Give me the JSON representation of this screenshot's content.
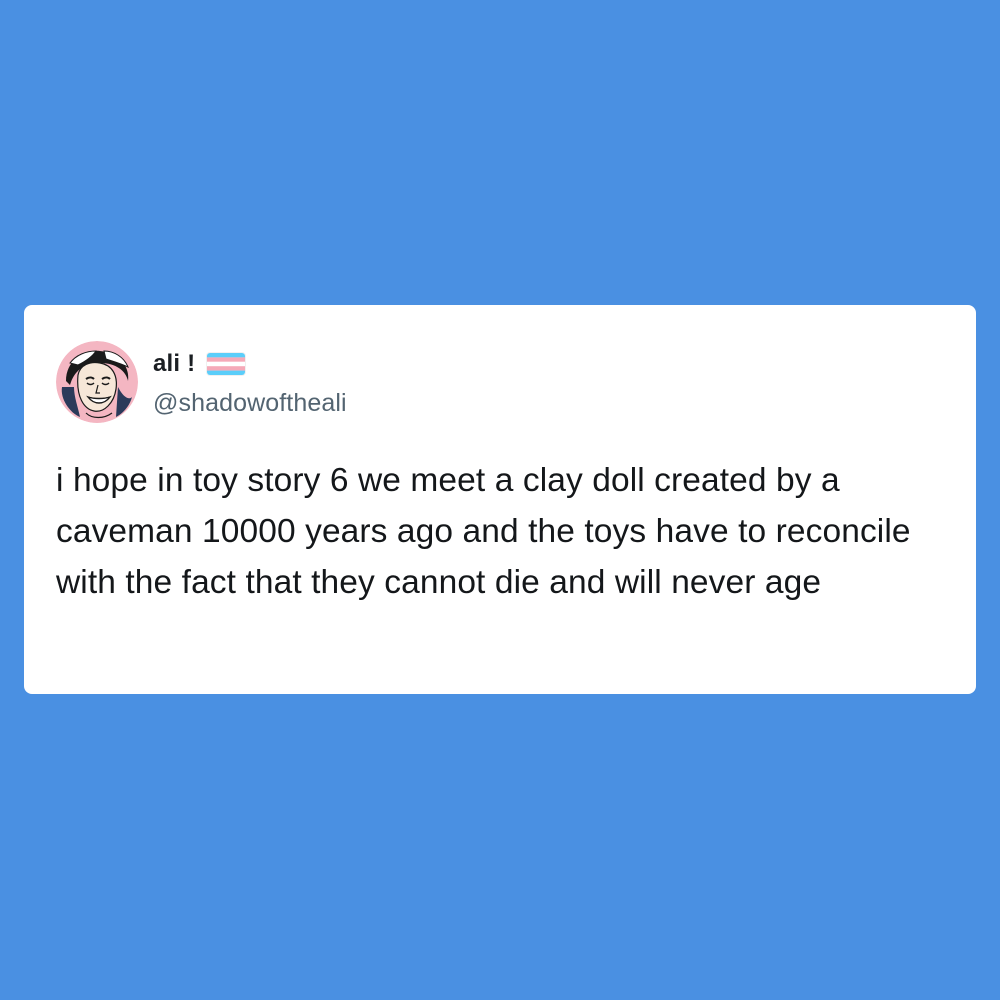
{
  "post": {
    "author": {
      "display_name": "ali !",
      "flag_icon": "trans-pride-flag-icon",
      "handle": "@shadowoftheali",
      "avatar_icon": "avatar-icon"
    },
    "text": "i hope in toy story 6 we meet a clay doll created by a caveman 10000 years ago and the toys have to reconcile with the fact that they cannot die and will never age"
  },
  "colors": {
    "background": "#4a90e2",
    "card": "#ffffff",
    "text": "#14171a",
    "handle": "#536471",
    "flag_blue": "#5bcefa",
    "flag_pink": "#f5a9b8",
    "flag_white": "#ffffff"
  }
}
